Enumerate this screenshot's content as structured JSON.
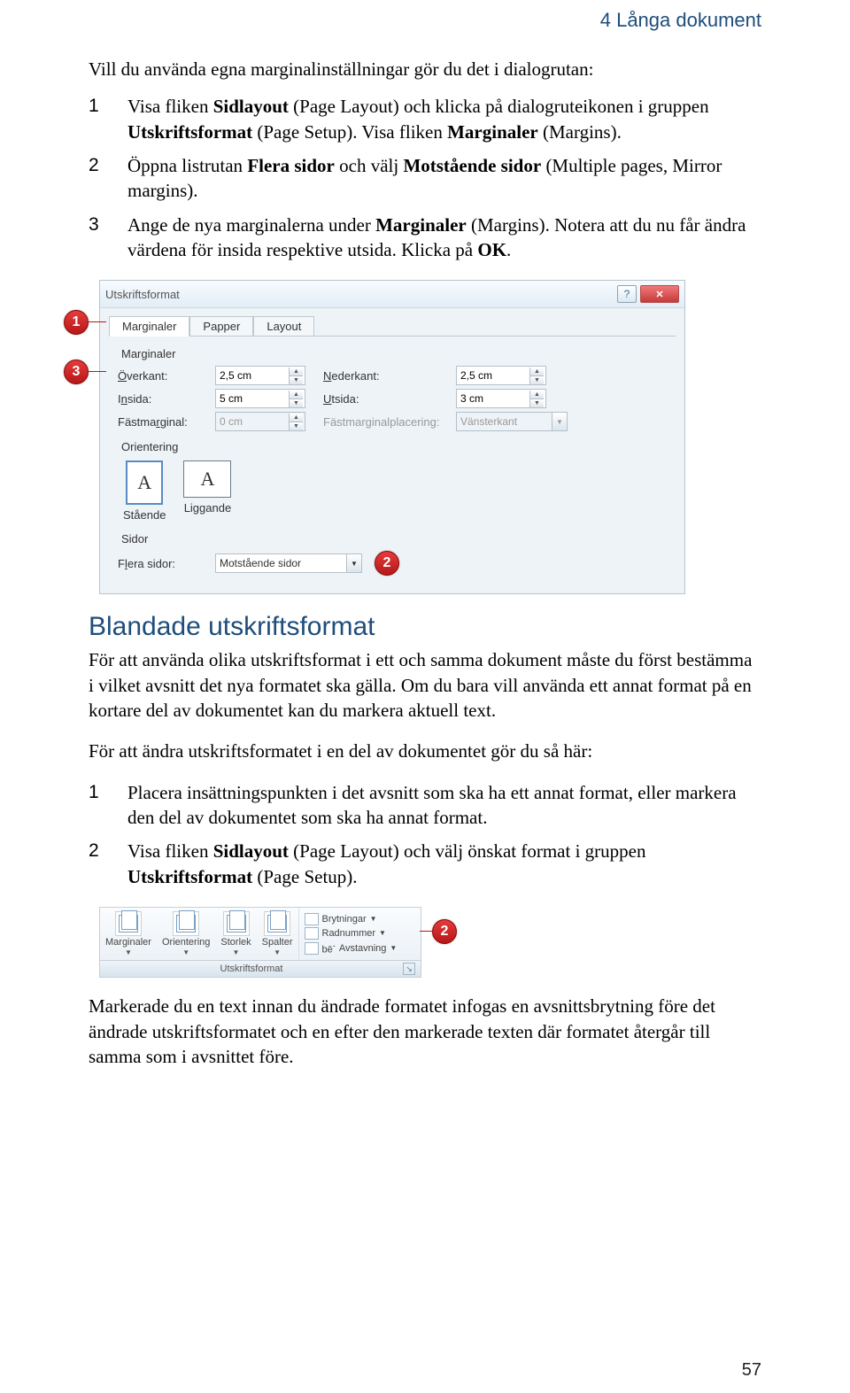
{
  "chapter": "4 Långa dokument",
  "intro": "Vill du använda egna marginalinställningar gör du det i dialogrutan:",
  "steps1": {
    "s1a": "Visa fliken ",
    "s1b": "Sidlayout",
    "s1c": " (Page Layout) och klicka på dialogruteikonen i gruppen ",
    "s1d": "Utskriftsformat",
    "s1e": " (Page Setup). Visa fliken ",
    "s1f": "Marginaler",
    "s1g": " (Margins).",
    "s2a": "Öppna listrutan ",
    "s2b": "Flera sidor",
    "s2c": " och välj ",
    "s2d": "Motstående sidor",
    "s2e": " (Multiple pages, Mirror margins).",
    "s3a": "Ange de nya marginalerna under ",
    "s3b": "Marginaler",
    "s3c": " (Margins). Notera att du nu får ändra värdena för insida respektive utsida. Klicka på ",
    "s3d": "OK",
    "s3e": "."
  },
  "dialog": {
    "title": "Utskriftsformat",
    "tab1": "Marginaler",
    "tab2": "Papper",
    "tab3": "Layout",
    "group_marg": "Marginaler",
    "overkant_l": "Överkant:",
    "overkant_v": "2,5 cm",
    "nederkant_l": "Nederkant:",
    "nederkant_v": "2,5 cm",
    "insida_l": "Insida:",
    "insida_v": "5 cm",
    "utsida_l": "Utsida:",
    "utsida_v": "3 cm",
    "fast_l": "Fästmarginal:",
    "fast_v": "0 cm",
    "fastpos_l": "Fästmarginalplacering:",
    "fastpos_v": "Vänsterkant",
    "group_orient": "Orientering",
    "orient_port": "Stående",
    "orient_land": "Liggande",
    "group_sidor": "Sidor",
    "flera_l": "Flera sidor:",
    "flera_v": "Motstående sidor"
  },
  "badges": {
    "b1": "1",
    "b2": "2",
    "b3": "3"
  },
  "section2": {
    "heading": "Blandade utskriftsformat",
    "p1": "För att använda olika utskriftsformat i ett och samma dokument måste du först bestämma i vilket avsnitt det nya formatet ska gälla. Om du bara vill använda ett annat format på en kortare del av dokumentet kan du markera aktuell text.",
    "p2": "För att ändra utskriftsformatet i en del av dokumentet gör du så här:",
    "s1": "Placera insättningspunkten i det avsnitt som ska ha ett annat format, eller markera den del av dokumentet som ska ha annat format.",
    "s2a": "Visa fliken ",
    "s2b": "Sidlayout",
    "s2c": " (Page Layout) och välj önskat format i gruppen ",
    "s2d": "Utskriftsformat",
    "s2e": " (Page Setup)."
  },
  "ribbon": {
    "g1": "Marginaler",
    "g2": "Orientering",
    "g3": "Storlek",
    "g4": "Spalter",
    "r1": "Brytningar",
    "r2": "Radnummer",
    "r3": "Avstavning",
    "grouplabel": "Utskriftsformat"
  },
  "closing": "Markerade du en text innan du ändrade formatet infogas en avsnittsbrytning före det ändrade utskriftsformatet och en efter den markerade texten där formatet återgår till samma som i avsnittet före.",
  "pagenum": "57"
}
